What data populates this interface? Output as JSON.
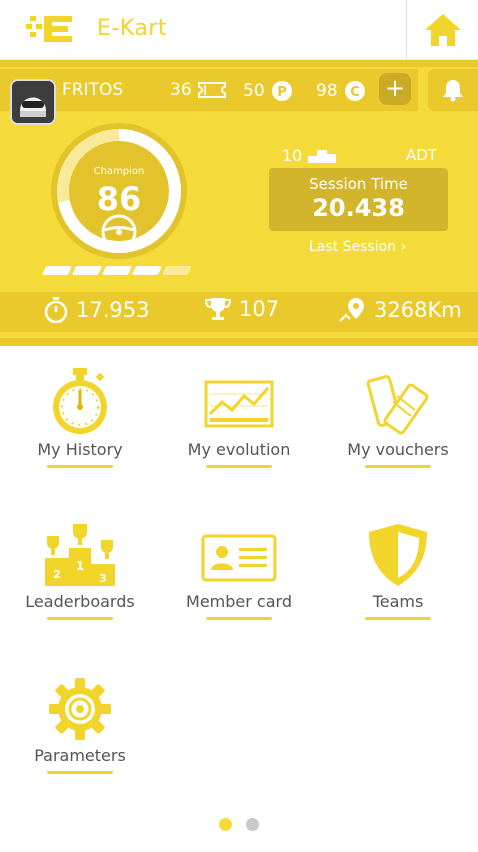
{
  "app": {
    "title": "E-Kart"
  },
  "profile": {
    "username": "FRITOS",
    "tickets": "36",
    "points": "50",
    "credits": "98",
    "plus_label": "+"
  },
  "gauge": {
    "rank_label": "Champion",
    "score": "86",
    "progress_fraction": 0.72,
    "level_segments_filled": 4,
    "level_segments_total": 5
  },
  "session": {
    "best_count": "10",
    "track_code": "ADT",
    "title": "Session Time",
    "value": "20.438",
    "last_session_label": "Last Session"
  },
  "stats": {
    "best_lap": "17.953",
    "trophies": "107",
    "distance": "3268Km"
  },
  "menu": [
    {
      "label": "My History"
    },
    {
      "label": "My evolution"
    },
    {
      "label": "My vouchers"
    },
    {
      "label": "Leaderboards"
    },
    {
      "label": "Member card"
    },
    {
      "label": "Teams"
    },
    {
      "label": "Parameters"
    }
  ],
  "pager": {
    "pages": 2,
    "active": 0
  },
  "colors": {
    "accent": "#f4db3a",
    "accent_dark": "#e9c92c",
    "text": "#555555"
  }
}
